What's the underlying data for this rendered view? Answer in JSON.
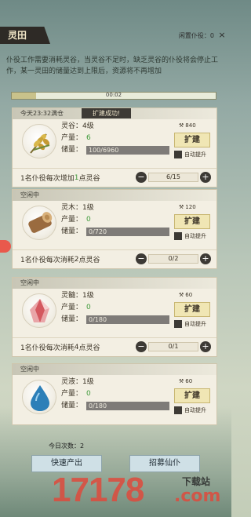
{
  "header": {
    "title": "灵田",
    "idle_label": "闲置仆役：0",
    "close_icon": "×"
  },
  "description": "仆役工作需要消耗灵谷，当灵谷不足时，缺乏灵谷的仆役将会停止工作，某一灵田的储量达到上限后，资源将不再增加",
  "timer": {
    "text": "00:02",
    "progress": 0.12
  },
  "fields": [
    {
      "status": "今天23:32满仓",
      "toast": "扩建成功!",
      "item_icon": "wheat-icon",
      "name": "灵谷：4级",
      "output_label": "产量：",
      "output_value": "6",
      "storage_label": "储量：",
      "storage_value": "100/6960",
      "cost": "840",
      "expand_label": "扩建",
      "auto_label": "自动提升",
      "footer_prefix": "1名仆役每次增加",
      "footer_num": "1",
      "footer_suffix": "点灵谷",
      "stepper_value": "6/15"
    },
    {
      "status": "空闲中",
      "toast": "",
      "item_icon": "wood-log-icon",
      "name": "灵木：1级",
      "output_label": "产量：",
      "output_value": "0",
      "storage_label": "储量：",
      "storage_value": "0/720",
      "cost": "120",
      "expand_label": "扩建",
      "auto_label": "自动提升",
      "footer_prefix": "1名仆役每次消耗",
      "footer_num": "2",
      "footer_suffix": "点灵谷",
      "stepper_value": "0/2"
    },
    {
      "status": "空闲中",
      "toast": "",
      "item_icon": "crystal-icon",
      "name": "灵髓：1级",
      "output_label": "产量：",
      "output_value": "0",
      "storage_label": "储量：",
      "storage_value": "0/180",
      "cost": "60",
      "expand_label": "扩建",
      "auto_label": "自动提升",
      "footer_prefix": "1名仆役每次消耗",
      "footer_num": "4",
      "footer_suffix": "点灵谷",
      "stepper_value": "0/1"
    },
    {
      "status": "空闲中",
      "toast": "",
      "item_icon": "water-drop-icon",
      "name": "灵液：1级",
      "output_label": "产量：",
      "output_value": "0",
      "storage_label": "储量：",
      "storage_value": "0/180",
      "cost": "60",
      "expand_label": "扩建",
      "auto_label": "自动提升",
      "footer_prefix": "",
      "footer_num": "",
      "footer_suffix": "",
      "stepper_value": ""
    }
  ],
  "today_count": "今日次数：2",
  "buttons": {
    "quick_output": "快速产出",
    "recruit": "招募仙仆"
  },
  "watermark": {
    "main": "17178",
    "dl": "下载站",
    "com": ".com"
  }
}
